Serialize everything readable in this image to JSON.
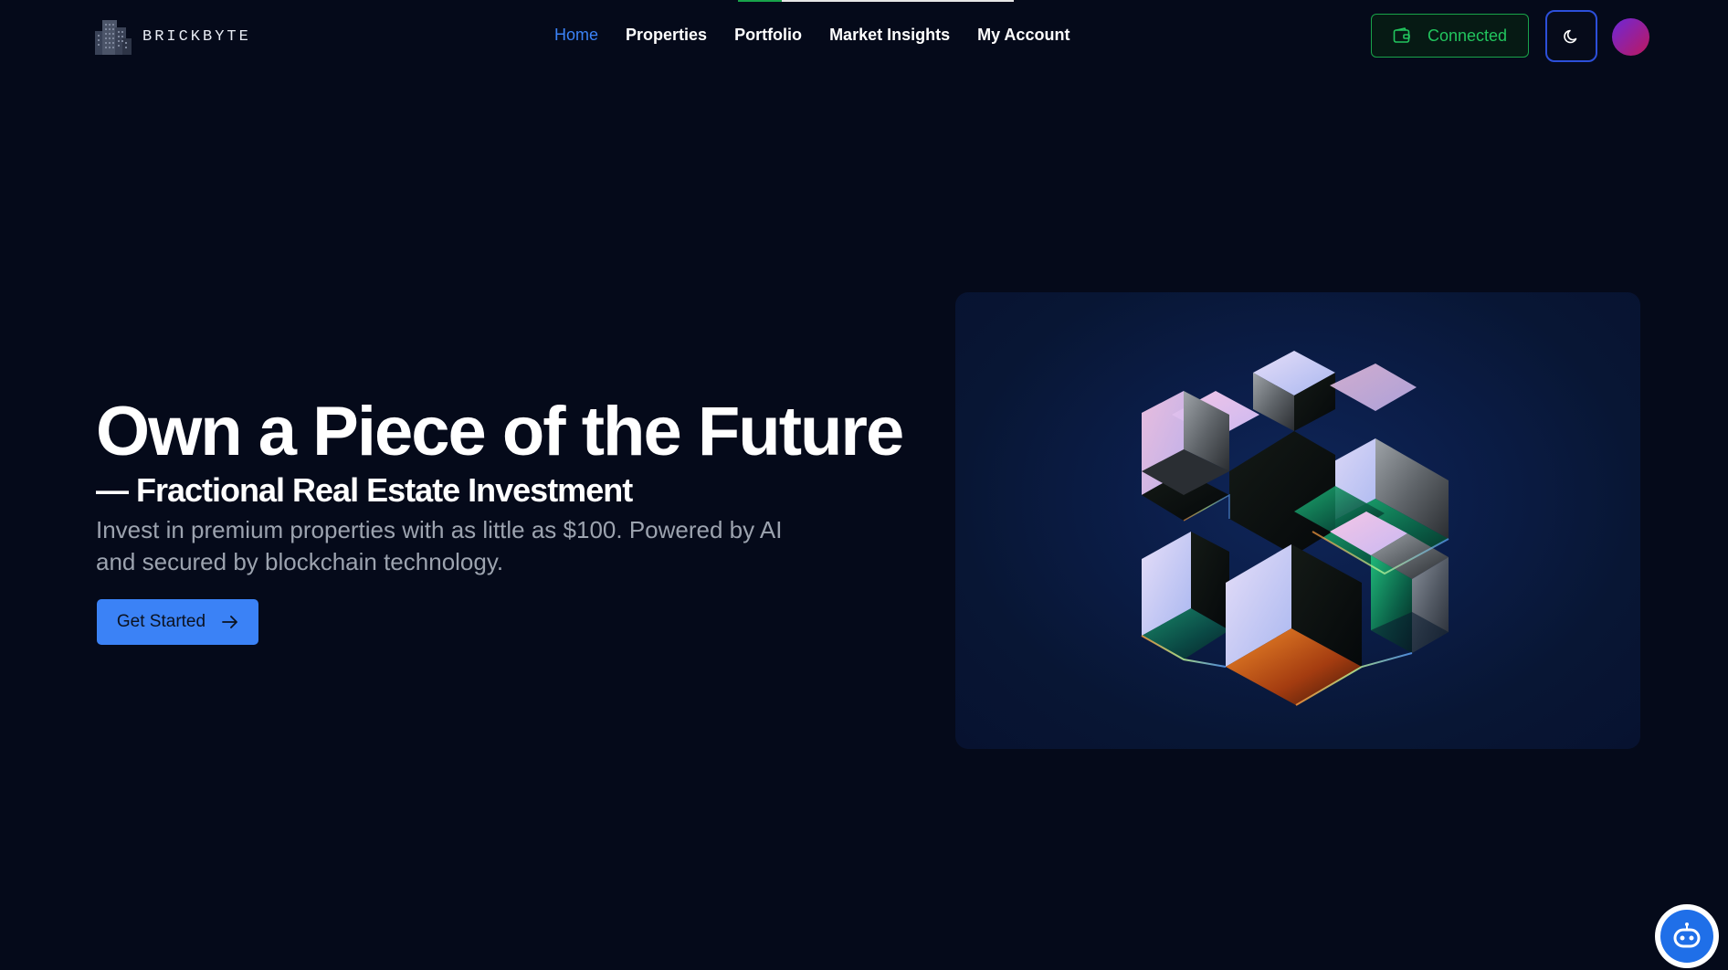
{
  "brand": {
    "name": "BRICKBYTE",
    "logo_icon": "building-icon"
  },
  "top_progress": {
    "fraction": 0.16
  },
  "nav": {
    "items": [
      {
        "label": "Home",
        "active": true
      },
      {
        "label": "Properties",
        "active": false
      },
      {
        "label": "Portfolio",
        "active": false
      },
      {
        "label": "Market Insights",
        "active": false
      },
      {
        "label": "My Account",
        "active": false
      }
    ]
  },
  "header": {
    "wallet_label": "Connected",
    "wallet_icon": "wallet-icon",
    "theme_icon": "moon-icon",
    "avatar_icon": "avatar"
  },
  "hero": {
    "title": "Own a Piece of the Future",
    "subtitle": "— Fractional Real Estate Investment",
    "description": "Invest in premium properties with as little as $100. Powered by AI and secured by blockchain technology.",
    "cta_label": "Get Started",
    "cta_icon": "arrow-right-icon",
    "art_icon": "iridescent-cubes-illustration"
  },
  "chatbot": {
    "icon": "robot-icon"
  },
  "colors": {
    "background": "#050a1a",
    "accent": "#3b82f6",
    "success": "#22c55e",
    "theme_border": "#2c4fd9",
    "muted_text": "#9ca3af"
  }
}
